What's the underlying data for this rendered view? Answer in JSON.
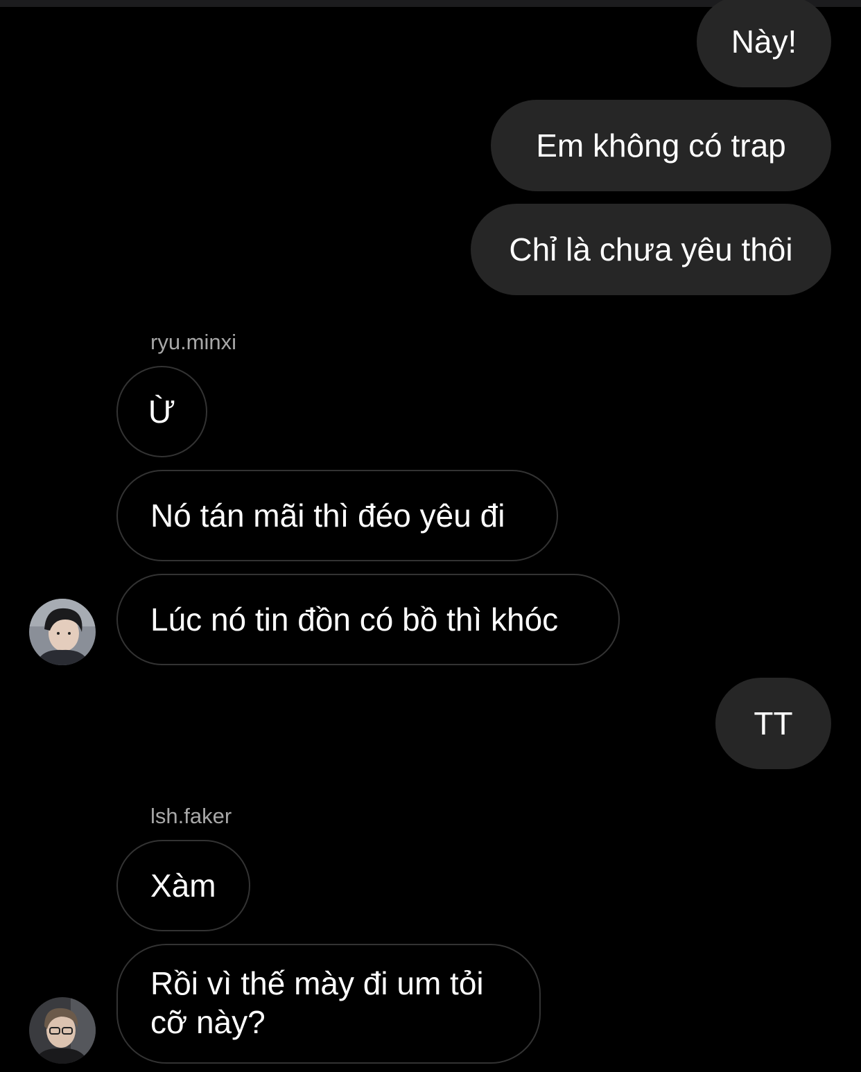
{
  "messages": [
    {
      "direction": "outgoing",
      "text": "Này!"
    },
    {
      "direction": "outgoing",
      "text": "Em không có trap"
    },
    {
      "direction": "outgoing",
      "text": "Chỉ là chưa yêu thôi"
    },
    {
      "direction": "incoming",
      "sender": "ryu.minxi",
      "text": "Ừ"
    },
    {
      "direction": "incoming",
      "sender": "ryu.minxi",
      "text": "Nó tán mãi thì đéo yêu đi"
    },
    {
      "direction": "incoming",
      "sender": "ryu.minxi",
      "text": "Lúc nó tin đồn có bồ thì khóc"
    },
    {
      "direction": "outgoing",
      "text": "TT"
    },
    {
      "direction": "incoming",
      "sender": "lsh.faker",
      "text": "Xàm"
    },
    {
      "direction": "incoming",
      "sender": "lsh.faker",
      "text": "Rồi vì thế mày đi um tỏi cỡ này?"
    }
  ],
  "senders": {
    "first": "ryu.minxi",
    "second": "lsh.faker"
  },
  "colors": {
    "background": "#000000",
    "outgoing_bubble": "#262626",
    "incoming_border": "#333333",
    "sender_label": "#a8a8a8"
  }
}
